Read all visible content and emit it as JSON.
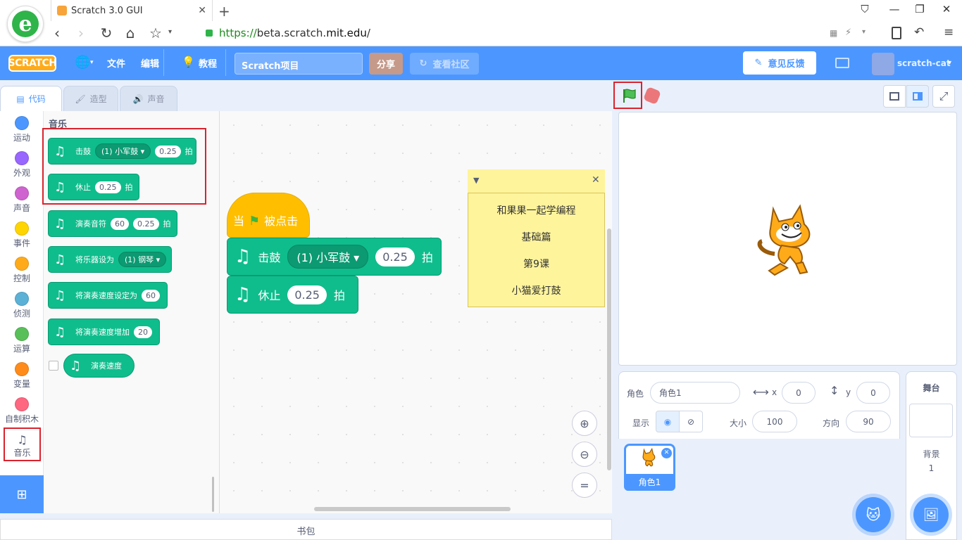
{
  "browser": {
    "tab_title": "Scratch 3.0 GUI",
    "url_scheme": "https://",
    "url_sub": "beta.scratch.",
    "url_domain": "mit.edu",
    "url_path": "/"
  },
  "menubar": {
    "logo": "SCRATCH",
    "file": "文件",
    "edit": "编辑",
    "tutorials": "教程",
    "project_title": "Scratch项目",
    "share": "分享",
    "see_community": "查看社区",
    "feedback": "意见反馈",
    "username": "scratch-cat"
  },
  "tabs": {
    "code": "代码",
    "costumes": "造型",
    "sounds": "声音"
  },
  "categories": [
    {
      "label": "运动",
      "color": "#4c97ff"
    },
    {
      "label": "外观",
      "color": "#9966ff"
    },
    {
      "label": "声音",
      "color": "#cf63cf"
    },
    {
      "label": "事件",
      "color": "#ffd500"
    },
    {
      "label": "控制",
      "color": "#ffab19"
    },
    {
      "label": "侦测",
      "color": "#5cb1d6"
    },
    {
      "label": "运算",
      "color": "#59c059"
    },
    {
      "label": "变量",
      "color": "#ff8c1a"
    },
    {
      "label": "自制积木",
      "color": "#ff6680"
    },
    {
      "label": "音乐",
      "color": "#0fbd8c"
    }
  ],
  "palette": {
    "heading": "音乐",
    "play_drum": {
      "label": "击鼓",
      "drum": "(1) 小军鼓",
      "beats": "0.25",
      "unit": "拍"
    },
    "rest": {
      "label": "休止",
      "beats": "0.25",
      "unit": "拍"
    },
    "play_note": {
      "label": "演奏音符",
      "note": "60",
      "beats": "0.25",
      "unit": "拍"
    },
    "set_instrument": {
      "label": "将乐器设为",
      "instrument": "(1) 钢琴"
    },
    "set_tempo": {
      "label": "将演奏速度设定为",
      "value": "60"
    },
    "change_tempo": {
      "label": "将演奏速度增加",
      "value": "20"
    },
    "tempo_reporter": {
      "label": "演奏速度"
    }
  },
  "workspace": {
    "hat": {
      "when": "当",
      "clicked": "被点击"
    },
    "drum": {
      "label": "击鼓",
      "drum": "(1) 小军鼓",
      "beats": "0.25",
      "unit": "拍"
    },
    "rest": {
      "label": "休止",
      "beats": "0.25",
      "unit": "拍"
    },
    "note_lines": [
      "和果果一起学编程",
      "基础篇",
      "第9课",
      "小猫爱打鼓"
    ]
  },
  "backpack": "书包",
  "sprite_info": {
    "sprite_label": "角色",
    "sprite_name": "角色1",
    "x_label": "x",
    "x_value": "0",
    "y_label": "y",
    "y_value": "0",
    "show_label": "显示",
    "size_label": "大小",
    "size_value": "100",
    "direction_label": "方向",
    "direction_value": "90"
  },
  "sprite_tile": "角色1",
  "stage_pane": {
    "title": "舞台",
    "backdrops_label": "背景",
    "backdrops_count": "1"
  },
  "colors": {
    "accent": "#4c97ff",
    "music": "#0fbd8c",
    "events": "#ffbf00",
    "highlight": "#d9232e"
  }
}
